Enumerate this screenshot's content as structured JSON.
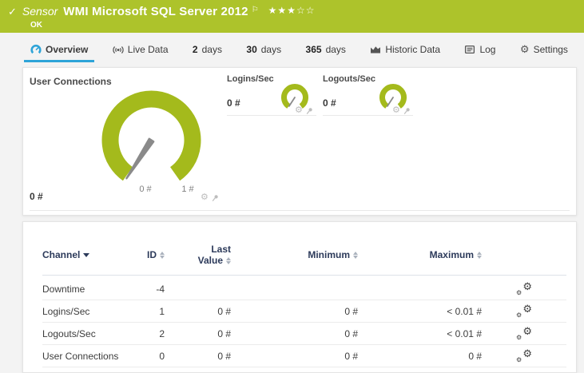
{
  "header": {
    "kind": "Sensor",
    "title": "WMI Microsoft SQL Server 2012",
    "status": "OK",
    "stars_filled": "★★★",
    "stars_empty": "☆☆"
  },
  "icons": {
    "check": "✓",
    "flag": "⚐",
    "gear": "⚙"
  },
  "tabs": [
    {
      "label": "Overview",
      "active": true
    },
    {
      "label": "Live Data"
    },
    {
      "prefix": "2",
      "label": "days"
    },
    {
      "prefix": "30",
      "label": "days"
    },
    {
      "prefix": "365",
      "label": "days"
    },
    {
      "label": "Historic Data"
    },
    {
      "label": "Log"
    },
    {
      "label": "Settings"
    }
  ],
  "gauges": {
    "user_connections": {
      "title": "User Connections",
      "value": "0 #",
      "scale_min": "0 #",
      "scale_max": "1 #"
    },
    "logins": {
      "title": "Logins/Sec",
      "value": "0 #"
    },
    "logouts": {
      "title": "Logouts/Sec",
      "value": "0 #"
    }
  },
  "colors": {
    "header_green": "#adc32b",
    "gauge_green": "#a4ba1c",
    "accent_blue": "#2ea4d8",
    "table_header_navy": "#2c3a5a"
  },
  "table": {
    "headers": {
      "channel": "Channel",
      "id": "ID",
      "last_line1": "Last",
      "last_line2": "Value",
      "minimum": "Minimum",
      "maximum": "Maximum"
    },
    "rows": [
      {
        "channel": "Downtime",
        "id": "-4",
        "last": "",
        "min": "",
        "max": ""
      },
      {
        "channel": "Logins/Sec",
        "id": "1",
        "last": "0 #",
        "min": "0 #",
        "max": "< 0.01 #"
      },
      {
        "channel": "Logouts/Sec",
        "id": "2",
        "last": "0 #",
        "min": "0 #",
        "max": "< 0.01 #"
      },
      {
        "channel": "User Connections",
        "id": "0",
        "last": "0 #",
        "min": "0 #",
        "max": "0 #"
      }
    ]
  }
}
